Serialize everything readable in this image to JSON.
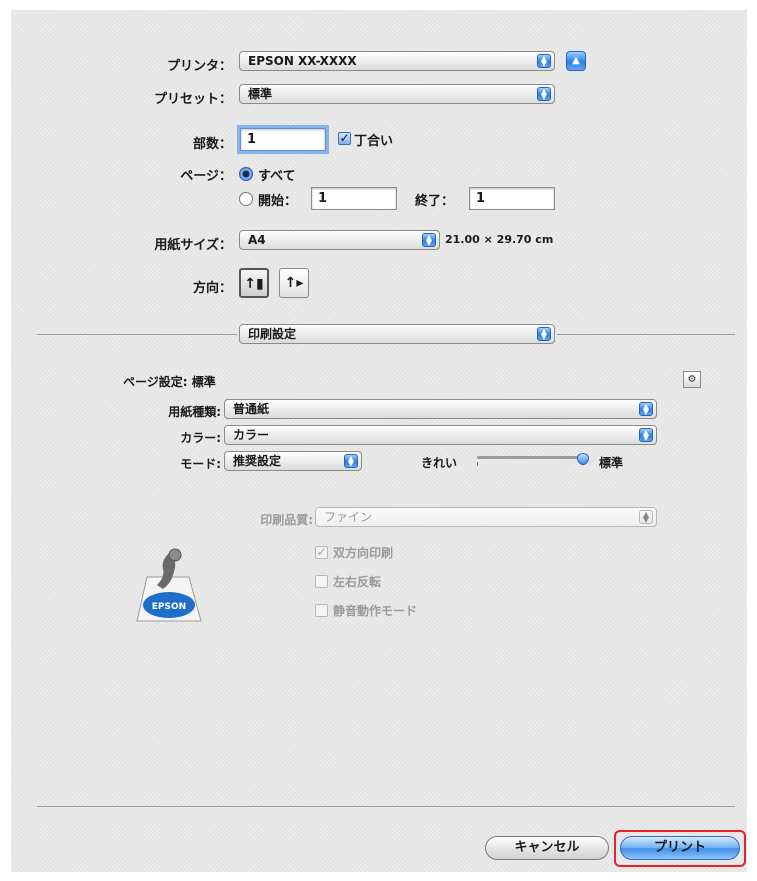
{
  "printer": {
    "label": "プリンタ：",
    "value": "EPSON XX-XXXX"
  },
  "preset": {
    "label": "プリセット：",
    "value": "標準"
  },
  "copies": {
    "label": "部数：",
    "value": "1",
    "collate_label": "丁合い",
    "collate_checked": true
  },
  "pages": {
    "label": "ページ：",
    "all_label": "すべて",
    "from_label": "開始：",
    "from_value": "1",
    "to_label": "終了：",
    "to_value": "1"
  },
  "paper_size": {
    "label": "用紙サイズ：",
    "value": "A4",
    "dimensions": "21.00 × 29.70 cm"
  },
  "orientation": {
    "label": "方向："
  },
  "panel_select": {
    "value": "印刷設定"
  },
  "page_setup": {
    "label": "ページ設定:",
    "value": "標準"
  },
  "media_type": {
    "label": "用紙種類:",
    "value": "普通紙"
  },
  "color": {
    "label": "カラー:",
    "value": "カラー"
  },
  "mode": {
    "label": "モード:",
    "value": "推奨設定",
    "slider_left": "きれい",
    "slider_right": "標準",
    "slider_level": 1.0
  },
  "print_quality": {
    "label": "印刷品質:",
    "value": "ファイン"
  },
  "options": {
    "bidirectional": "双方向印刷",
    "mirror": "左右反転",
    "quiet": "静音動作モード"
  },
  "brand_logo": "EPSON",
  "buttons": {
    "cancel": "キャンセル",
    "print": "プリント"
  },
  "colors": {
    "accent": "#3f8ce8",
    "highlight": "#e8202e"
  }
}
